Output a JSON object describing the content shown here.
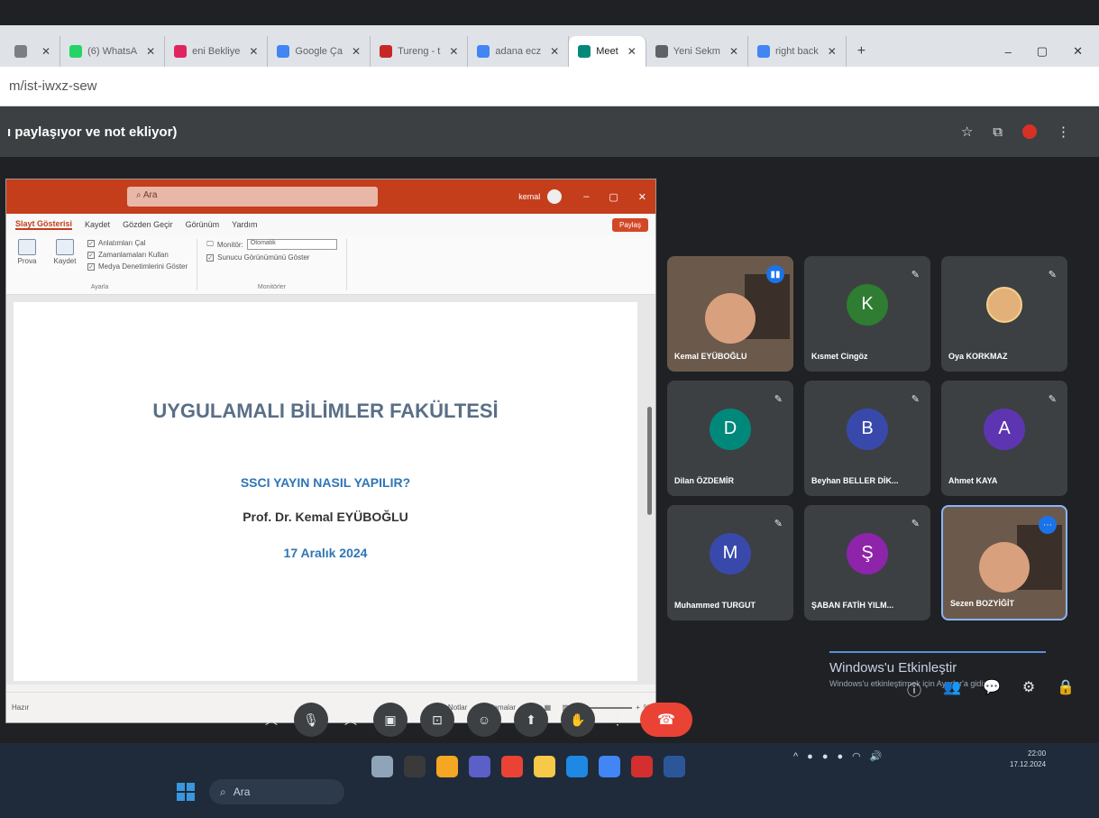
{
  "browser": {
    "tabs": [
      {
        "label": "",
        "fav": "#7b7f85"
      },
      {
        "label": "(6) WhatsA",
        "fav": "#25d366"
      },
      {
        "label": "eni Bekliye",
        "fav": "#e0245e"
      },
      {
        "label": "Google Ça",
        "fav": "#4285f4"
      },
      {
        "label": "Tureng - t",
        "fav": "#c62828"
      },
      {
        "label": "adana ecz",
        "fav": "#4285f4"
      },
      {
        "label": "Meet",
        "fav": "#00897b",
        "active": true
      },
      {
        "label": "Yeni Sekm",
        "fav": "#5f6368"
      },
      {
        "label": "right back",
        "fav": "#4285f4"
      }
    ],
    "new_tab": "+",
    "window_controls": {
      "minimize": "–",
      "restore": "▢",
      "close": "✕"
    },
    "url": "m/ist-iwxz-sew"
  },
  "meet": {
    "presenter_note": "ı paylaşıyor ve not ekliyor)",
    "header_icons": [
      "star-icon",
      "extensions-icon",
      "profile-icon",
      "more-icon"
    ],
    "participants": [
      {
        "name": "Kemal EYÜBOĞLU",
        "type": "video",
        "speaking": true
      },
      {
        "name": "Kısmet Cingöz",
        "initial": "K",
        "color": "#2e7d32",
        "muted": true
      },
      {
        "name": "Oya KORKMAZ",
        "type": "photo",
        "muted": true
      },
      {
        "name": "Dilan ÖZDEMİR",
        "initial": "D",
        "color": "#00897b",
        "muted": true
      },
      {
        "name": "Beyhan BELLER DİK...",
        "initial": "B",
        "color": "#3949ab",
        "muted": true
      },
      {
        "name": "Ahmet KAYA",
        "initial": "A",
        "color": "#5e35b1",
        "muted": true
      },
      {
        "name": "Muhammed TURGUT",
        "initial": "M",
        "color": "#3949ab",
        "muted": true
      },
      {
        "name": "ŞABAN FATİH YILM...",
        "initial": "Ş",
        "color": "#8e24aa",
        "muted": true
      },
      {
        "name": "Sezen BOZYİĞİT",
        "type": "video",
        "active": true
      }
    ],
    "controls": [
      "chevron-up-icon",
      "mic-icon",
      "chevron-up-icon",
      "camera-icon",
      "captions-icon",
      "emoji-icon",
      "present-icon",
      "raise-hand-icon",
      "more-vert-icon"
    ],
    "end_call": "hangup-icon"
  },
  "ppt": {
    "search_placeholder": "Ara",
    "user": "kemal",
    "menu": [
      "Slayt Gösterisi",
      "Kaydet",
      "Gözden Geçir",
      "Görünüm",
      "Yardım"
    ],
    "share": "Paylaş",
    "ribbon": {
      "btn1": "Prova",
      "btn2": "Kaydet",
      "group1_label": "Ayarla",
      "checks": [
        "Anlatımları Çal",
        "Zamanlamaları Kullan",
        "Medya Denetimlerini Göster"
      ],
      "monitor_label": "Monitör:",
      "monitor_value": "Otomatik",
      "presenter_view": "Sunucu Görünümünü Göster",
      "group2_label": "Monitörler"
    },
    "slide": {
      "title": "UYGULAMALI BİLİMLER FAKÜLTESİ",
      "subtitle": "SSCI YAYIN NASIL YAPILIR?",
      "author": "Prof. Dr. Kemal EYÜBOĞLU",
      "date": "17 Aralık 2024"
    },
    "status": {
      "left": "Hazır",
      "notes": "Notlar",
      "comments": "Açıklamalar",
      "zoom": "%"
    }
  },
  "windows": {
    "activate_title": "Windows'u Etkinleştir",
    "activate_sub": "Windows'u etkinleştirmek için Ayarlar'a gidin.",
    "side_icons": [
      "info-icon",
      "people-icon",
      "chat-icon",
      "activities-icon",
      "lock-icon"
    ],
    "search_label": "Ara",
    "clock_time": "22:00",
    "clock_date": "17.12.2024",
    "apps": [
      "#8fa4b8",
      "#3a3a3a",
      "#f5a623",
      "#5b5fc7",
      "#ea4335",
      "#f7c948",
      "#1e88e5",
      "#4285f4",
      "#d32f2f",
      "#2b579a"
    ]
  }
}
